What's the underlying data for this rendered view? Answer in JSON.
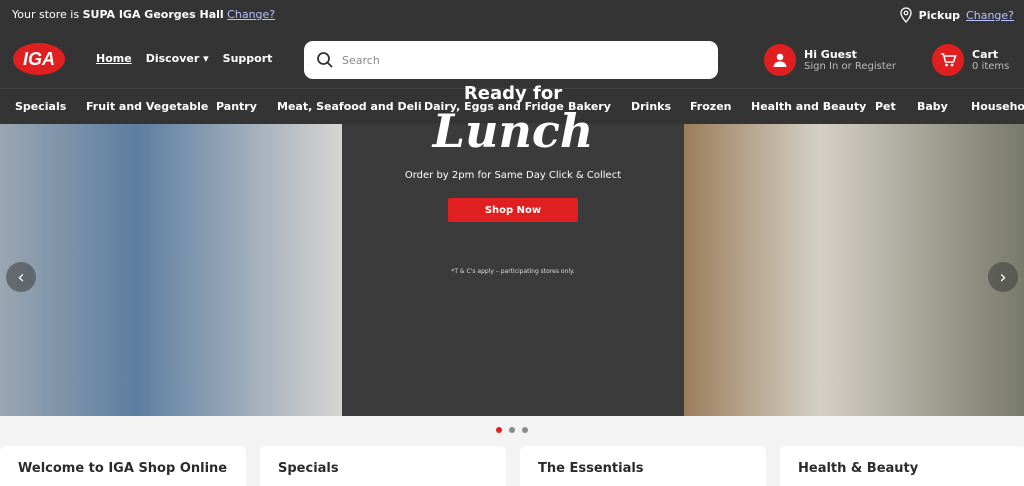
{
  "topbar": {
    "store_prefix": "Your store is",
    "store_name": "SUPA IGA Georges Hall",
    "change_label": "Change?",
    "pickup_label": "Pickup",
    "pickup_change_label": "Change?"
  },
  "header": {
    "logo_text": "IGA",
    "nav": [
      "Home",
      "Discover",
      "Support"
    ],
    "search_placeholder": "Search",
    "account_title": "Hi Guest",
    "account_sub": "Sign In or Register",
    "cart_title": "Cart",
    "cart_sub": "0 items"
  },
  "categories": [
    "Specials",
    "Fruit and Vegetable",
    "Pantry",
    "Meat, Seafood and Deli",
    "Dairy, Eggs and Fridge",
    "Bakery",
    "Drinks",
    "Frozen",
    "Health and Beauty",
    "Pet",
    "Baby",
    "Household"
  ],
  "hero": {
    "title": "Ready for",
    "main": "Lunch",
    "subtitle": "Order by 2pm for Same Day Click & Collect",
    "button": "Shop Now",
    "terms": "*T & C's apply – participating stores only.",
    "prev_icon": "‹",
    "next_icon": "›"
  },
  "cards": [
    "Welcome to IGA Shop Online",
    "Specials",
    "The Essentials",
    "Health & Beauty"
  ],
  "colors": {
    "dark": "#343434",
    "accent": "#e02020"
  }
}
